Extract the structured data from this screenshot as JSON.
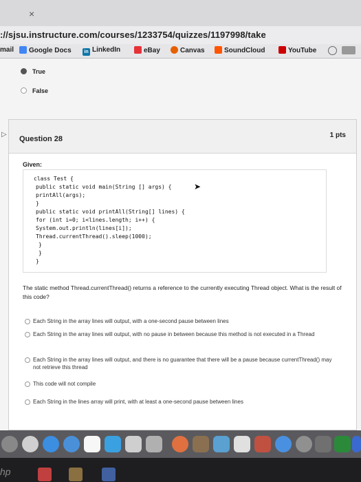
{
  "browser": {
    "tab_close": "×",
    "url": "://sjsu.instructure.com/courses/1233754/quizzes/1197998/take",
    "bookmarks": [
      {
        "label": "mail",
        "icon": "none"
      },
      {
        "label": "Google Docs",
        "icon": "google-docs-icon"
      },
      {
        "label": "LinkedIn",
        "icon": "linkedin-icon"
      },
      {
        "label": "eBay",
        "icon": "ebay-icon"
      },
      {
        "label": "Canvas",
        "icon": "canvas-icon"
      },
      {
        "label": "SoundCloud",
        "icon": "soundcloud-icon"
      },
      {
        "label": "YouTube",
        "icon": "youtube-icon"
      }
    ]
  },
  "previous_question": {
    "options": [
      {
        "label": "True",
        "selected": true
      },
      {
        "label": "False",
        "selected": false
      }
    ]
  },
  "question": {
    "title": "Question 28",
    "points": "1 pts",
    "given_label": "Given:",
    "code": [
      "class Test {",
      "public static void main(String [] args) {",
      "printAll(args);",
      "}",
      "public static void printAll(String[] lines) {",
      "for (int i=0; i<lines.length; i++) {",
      "System.out.println(lines[i]);",
      "Thread.currentThread().sleep(1000);",
      "}",
      "}",
      "}"
    ],
    "prompt": "The static method Thread.currentThread() returns a reference to the currently executing Thread object. What is the result of this code?",
    "answers": [
      "Each String in the array lines will output, with a one-second pause between lines",
      "Each String in the array lines will output, with no pause in between because this method is not executed in a Thread",
      "Each String in the array lines will output, and there is no guarantee that there will be a pause because currentThread() may not retrieve this thread",
      "This code will not compile",
      "Each String in the lines array will print, with at least a one-second pause between lines"
    ]
  },
  "laptop": {
    "brand": "hp"
  },
  "colors": {
    "linkedin": "#0e76a8",
    "ebay": "#e53238",
    "canvas": "#e66000",
    "soundcloud": "#ff5500",
    "youtube": "#cc0000",
    "google_docs": "#4285f4"
  }
}
